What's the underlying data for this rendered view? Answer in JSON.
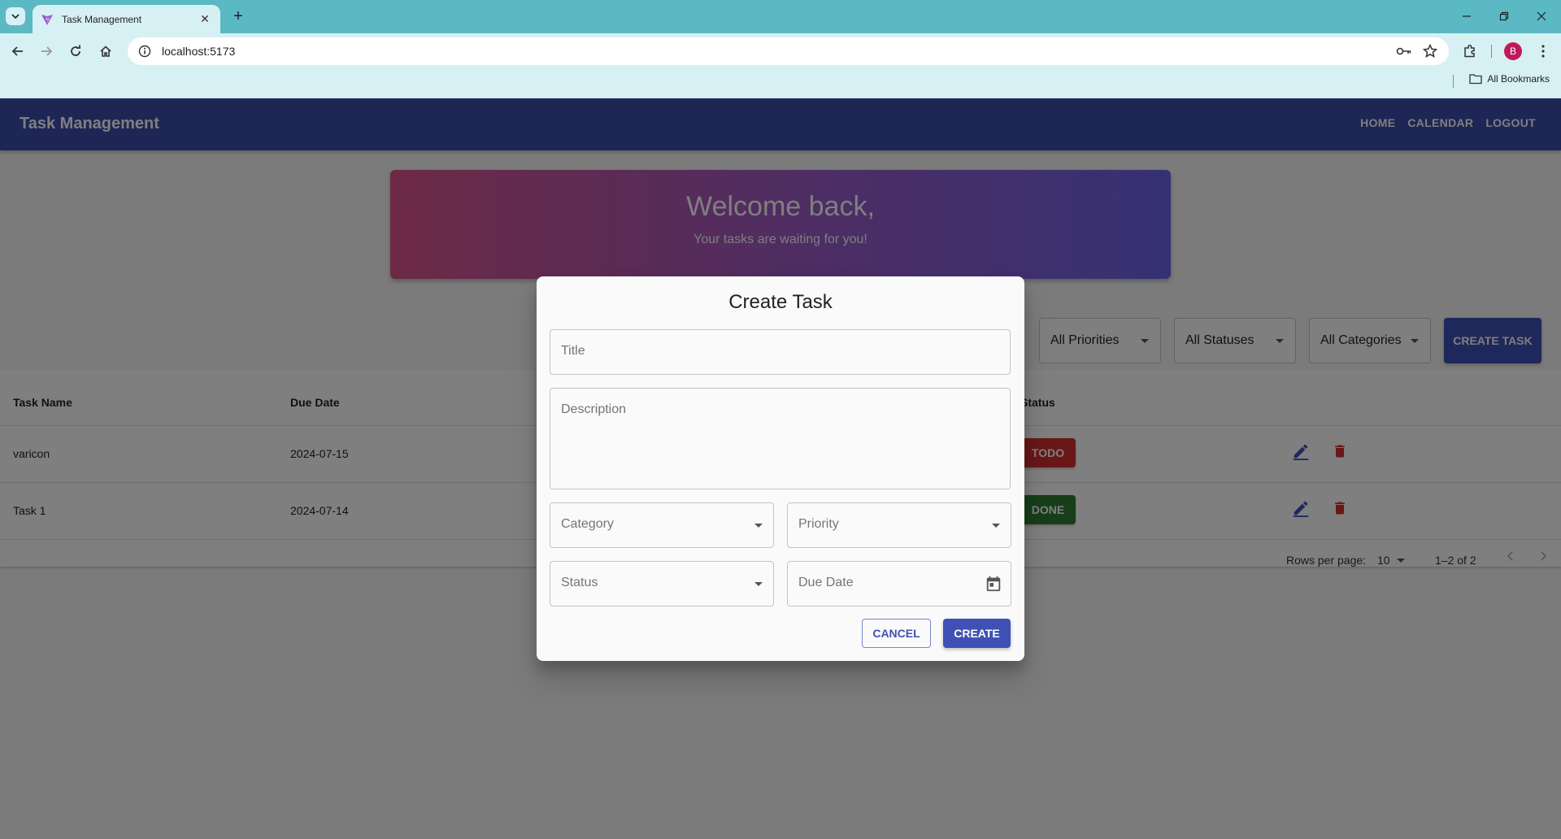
{
  "browser": {
    "tab_title": "Task Management",
    "url": "localhost:5173",
    "bookmarks_label": "All Bookmarks",
    "profile_initial": "B"
  },
  "app": {
    "title": "Task Management",
    "nav": [
      "HOME",
      "CALENDAR",
      "LOGOUT"
    ]
  },
  "welcome": {
    "title": "Welcome back,",
    "subtitle": "Your tasks are waiting for you!"
  },
  "filters": {
    "priorities": "All Priorities",
    "statuses": "All Statuses",
    "categories": "All Categories",
    "create_button": "CREATE TASK"
  },
  "table": {
    "headers": {
      "task_name": "Task Name",
      "due_date": "Due Date",
      "status": "Status"
    },
    "rows": [
      {
        "name": "varicon",
        "due": "2024-07-15",
        "status": "TODO",
        "status_color": "#d32f2f"
      },
      {
        "name": "Task 1",
        "due": "2024-07-14",
        "status": "DONE",
        "status_color": "#2e7d32"
      }
    ],
    "pagination": {
      "rows_per_page_label": "Rows per page:",
      "rows_per_page": "10",
      "range": "1–2 of 2"
    }
  },
  "modal": {
    "title": "Create Task",
    "fields": {
      "title": "Title",
      "description": "Description",
      "category": "Category",
      "priority": "Priority",
      "status": "Status",
      "due_date": "Due Date"
    },
    "cancel": "CANCEL",
    "create": "CREATE"
  },
  "colors": {
    "primary": "#3f51b5",
    "appbar": "#3a4ca8",
    "todo": "#d32f2f",
    "done": "#2e7d32",
    "delete": "#d32f2f"
  }
}
